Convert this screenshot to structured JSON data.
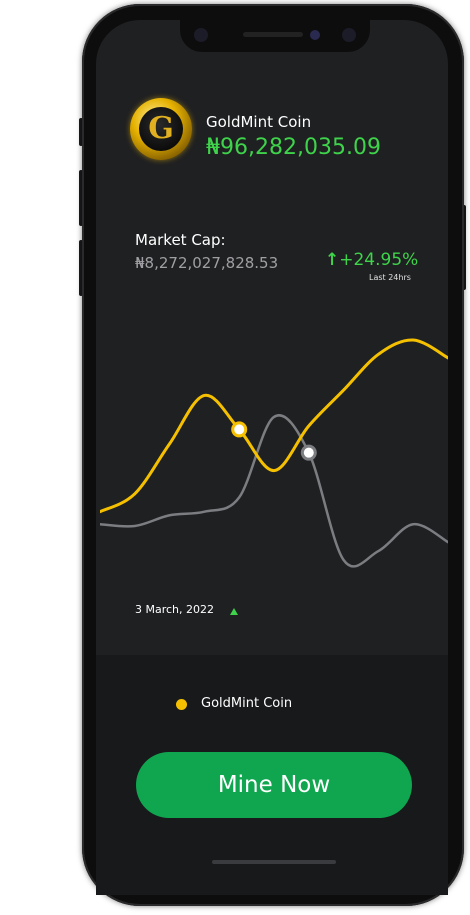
{
  "coin": {
    "name": "GoldMint Coin",
    "price": "₦96,282,035.09",
    "logo_letter": "G"
  },
  "market": {
    "label": "Market Cap:",
    "value": "₦8,272,027,828.53",
    "change": "+24.95%",
    "change_period": "Last 24hrs"
  },
  "chart_data": {
    "type": "line",
    "x": [
      0,
      1,
      2,
      3,
      4,
      5,
      6,
      7,
      8,
      9,
      10
    ],
    "series": [
      {
        "name": "GoldMint Coin",
        "color": "#f5c000",
        "values": [
          0.12,
          0.22,
          0.5,
          0.77,
          0.58,
          0.35,
          0.6,
          0.8,
          1.0,
          1.08,
          0.98
        ]
      },
      {
        "color": "#7b7d81",
        "values": [
          0.05,
          0.04,
          0.1,
          0.12,
          0.2,
          0.65,
          0.45,
          -0.15,
          -0.1,
          0.05,
          -0.05
        ]
      }
    ],
    "highlight_points": [
      {
        "series": 0,
        "index": 4
      },
      {
        "series": 1,
        "index": 6
      }
    ],
    "grid": false
  },
  "footer": {
    "date": "3 March, 2022",
    "legend": "GoldMint Coin"
  },
  "actions": {
    "mine_label": "Mine Now"
  },
  "colors": {
    "accent_green": "#3ed34a",
    "button_green": "#0fa64f",
    "gold": "#f5c000"
  }
}
